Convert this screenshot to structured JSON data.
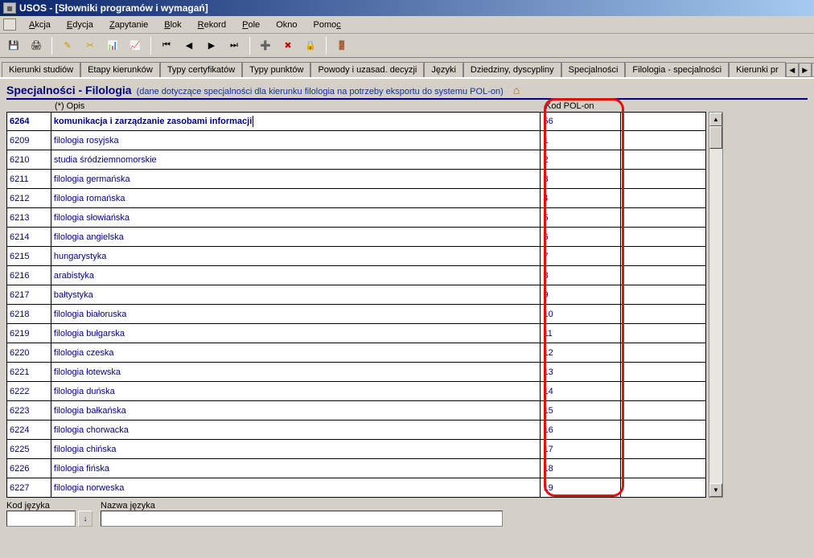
{
  "window": {
    "title": "USOS - [Słowniki programów i wymagań]"
  },
  "menu": {
    "items": [
      "Akcja",
      "Edycja",
      "Zapytanie",
      "Blok",
      "Rekord",
      "Pole",
      "Okno",
      "Pomoc"
    ]
  },
  "tabs": {
    "items": [
      "Kierunki studiów",
      "Etapy kierunków",
      "Typy certyfikatów",
      "Typy punktów",
      "Powody i uzasad. decyzji",
      "Języki",
      "Dziedziny, dyscypliny",
      "Specjalności",
      "Filologia - specjalności",
      "Kierunki pr"
    ],
    "active_index": 8
  },
  "heading": {
    "title": "Specjalności - Filologia",
    "subtitle": "(dane dotyczące specjalności dla kierunku filologia na potrzeby eksportu do systemu POL-on)"
  },
  "columns": {
    "opis": "(*) Opis",
    "kod": "Kod POL-on"
  },
  "rows": [
    {
      "id": "6264",
      "opis": "komunikacja i zarządzanie zasobami informacji",
      "kod": "56",
      "selected": true
    },
    {
      "id": "6209",
      "opis": "filologia rosyjska",
      "kod": "1"
    },
    {
      "id": "6210",
      "opis": "studia śródziemnomorskie",
      "kod": "2"
    },
    {
      "id": "6211",
      "opis": "filologia germańska",
      "kod": "3"
    },
    {
      "id": "6212",
      "opis": "filologia romańska",
      "kod": "4"
    },
    {
      "id": "6213",
      "opis": "filologia słowiańska",
      "kod": "5"
    },
    {
      "id": "6214",
      "opis": "filologia angielska",
      "kod": "6"
    },
    {
      "id": "6215",
      "opis": "hungarystyka",
      "kod": "7"
    },
    {
      "id": "6216",
      "opis": "arabistyka",
      "kod": "8"
    },
    {
      "id": "6217",
      "opis": "bałtystyka",
      "kod": "9"
    },
    {
      "id": "6218",
      "opis": "filologia białoruska",
      "kod": "10"
    },
    {
      "id": "6219",
      "opis": "filologia bułgarska",
      "kod": "11"
    },
    {
      "id": "6220",
      "opis": "filologia czeska",
      "kod": "12"
    },
    {
      "id": "6221",
      "opis": "filologia łotewska",
      "kod": "13"
    },
    {
      "id": "6222",
      "opis": "filologia duńska",
      "kod": "14"
    },
    {
      "id": "6223",
      "opis": "filologia bałkańska",
      "kod": "15"
    },
    {
      "id": "6224",
      "opis": "filologia chorwacka",
      "kod": "16"
    },
    {
      "id": "6225",
      "opis": "filologia chińska",
      "kod": "17"
    },
    {
      "id": "6226",
      "opis": "filologia fińska",
      "kod": "18"
    },
    {
      "id": "6227",
      "opis": "filologia norweska",
      "kod": "19"
    }
  ],
  "bottom": {
    "kod_jezyka_label": "Kod języka",
    "nazwa_jezyka_label": "Nazwa języka",
    "kod_jezyka_value": "",
    "nazwa_jezyka_value": ""
  },
  "icons": {
    "save": "💾",
    "print": "🖨",
    "edit": "✎",
    "cut": "✂",
    "chart1": "📊",
    "chart2": "📈",
    "first": "⏮",
    "prev": "◀",
    "next": "▶",
    "last": "⏭",
    "ins": "➕",
    "del": "✖",
    "lock": "🔒",
    "exit": "🚪",
    "down_arrow": "↓"
  }
}
